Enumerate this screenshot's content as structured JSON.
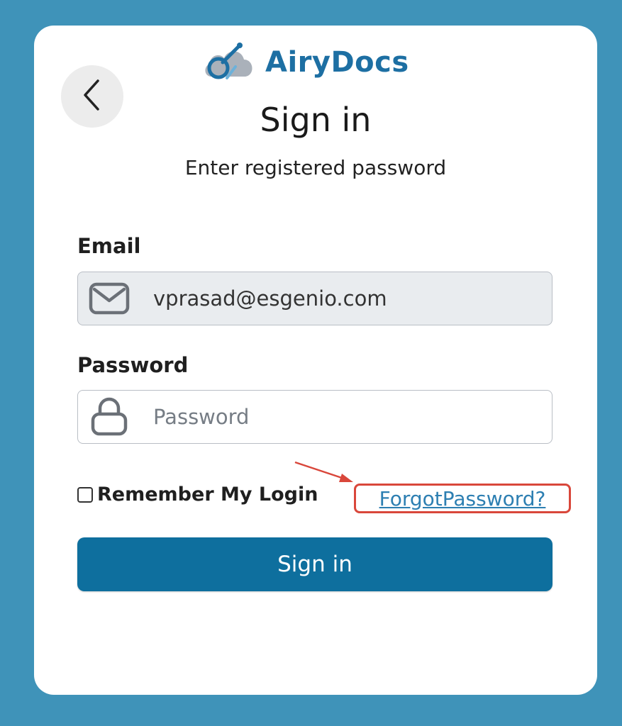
{
  "brand": {
    "name": "AiryDocs",
    "logo_icon": "cloud-link-icon",
    "color": "#1d6fa3"
  },
  "header": {
    "back_icon": "chevron-left-icon",
    "title": "Sign in",
    "subtitle": "Enter registered password"
  },
  "form": {
    "email": {
      "label": "Email",
      "value": "vprasad@esgenio.com",
      "icon": "mail-icon",
      "disabled": true
    },
    "password": {
      "label": "Password",
      "placeholder": "Password",
      "value": "",
      "icon": "lock-icon"
    },
    "remember": {
      "label": "Remember My Login",
      "checked": false
    },
    "forgot_link": "ForgotPassword?",
    "submit_label": "Sign in"
  },
  "annotation": {
    "highlight_color": "#d9473b"
  },
  "colors": {
    "background": "#3f93b9",
    "card": "#ffffff",
    "primary_button": "#0e6f9e",
    "link": "#2d7fb2"
  }
}
